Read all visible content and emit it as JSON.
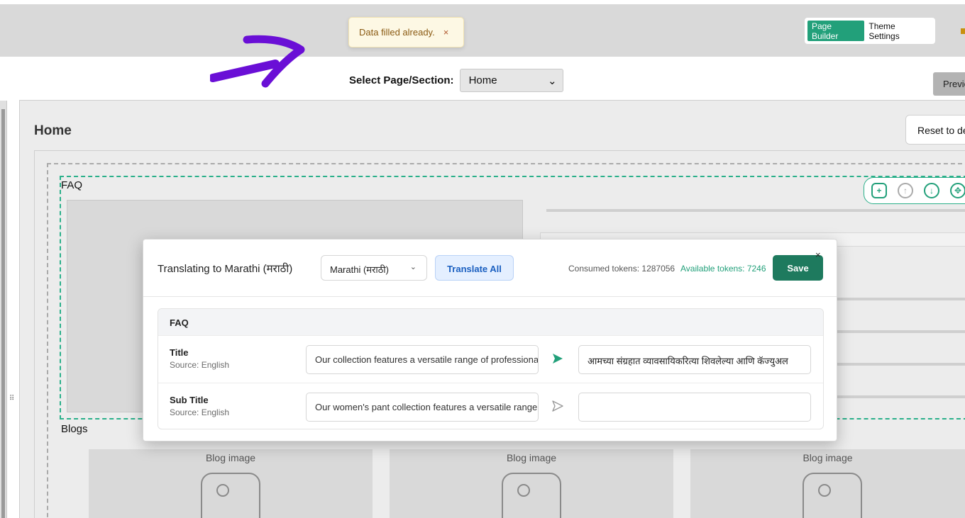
{
  "toast": {
    "message": "Data filled already.",
    "close": "×"
  },
  "builder_tabs": {
    "page_builder": "Page Builder",
    "theme_settings": "Theme Settings"
  },
  "select": {
    "label": "Select Page/Section:",
    "value": "Home",
    "chevron": "⌄"
  },
  "preview_label": "Previe",
  "page_title": "Home",
  "reset_label": "Reset to de",
  "sections": {
    "faq_label": "FAQ",
    "blogs_label": "Blogs",
    "blog_image_caption": "Blog image"
  },
  "drag_handle": "⠿",
  "modal": {
    "title": "Translating to Marathi (मराठी)",
    "language": "Marathi (मराठी)",
    "chevron": "⌄",
    "translate_all": "Translate All",
    "consumed": "Consumed tokens: 1287056",
    "available": "Available tokens: 7246",
    "save": "Save",
    "close": "×",
    "section_header": "FAQ",
    "rows": [
      {
        "name": "Title",
        "source": "Source: English",
        "source_value": "Our collection features a versatile range of professional",
        "target_value": "आमच्या संग्रहात व्यावसायिकरित्या शिवलेल्या आणि कॅज्युअल"
      },
      {
        "name": "Sub Title",
        "source": "Source: English",
        "source_value": "Our women's pant collection features a versatile range",
        "target_value": ""
      }
    ]
  },
  "colors": {
    "accent": "#22a07a",
    "save": "#1e7a5e",
    "arrow": "#6a0fd6"
  }
}
